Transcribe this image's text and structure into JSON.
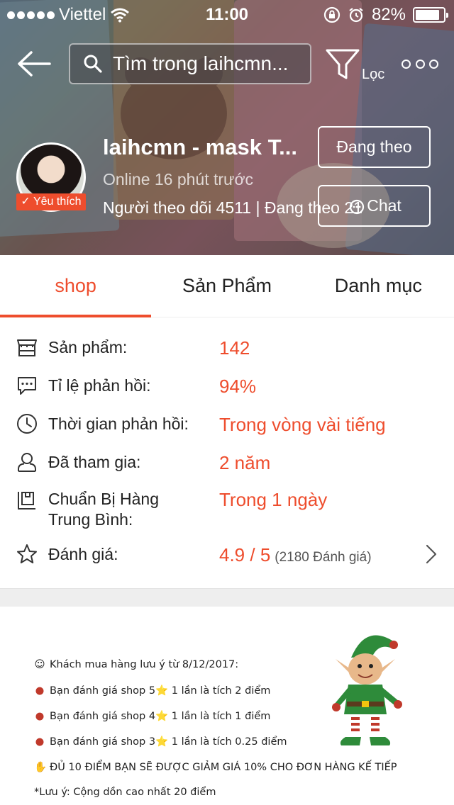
{
  "status_bar": {
    "carrier": "Viettel",
    "time": "11:00",
    "battery": "82%"
  },
  "header": {
    "search_placeholder": "Tìm trong laihcmn...",
    "filter_label": "Lọc"
  },
  "shop": {
    "name": "laihcmn - mask T...",
    "badge": "Yêu thích",
    "online": "Online 16 phút trước",
    "followers": "Người theo dõi 4511 | Đang theo 21",
    "follow_button": "Đang theo",
    "chat_button": "Chat"
  },
  "tabs": [
    {
      "label": "shop",
      "active": true
    },
    {
      "label": "Sản Phẩm",
      "active": false
    },
    {
      "label": "Danh mục",
      "active": false
    }
  ],
  "info": {
    "products_label": "Sản phẩm:",
    "products_value": "142",
    "response_rate_label": "Tỉ lệ phản hồi:",
    "response_rate_value": "94%",
    "response_time_label": "Thời gian phản hồi:",
    "response_time_value": "Trong vòng vài tiếng",
    "joined_label": "Đã tham gia:",
    "joined_value": "2 năm",
    "prep_label_1": "Chuẩn Bị Hàng",
    "prep_label_2": "Trung Bình:",
    "prep_value": "Trong 1 ngày",
    "rating_label": "Đánh giá:",
    "rating_value": "4.9 / 5",
    "rating_count": "(2180 Đánh giá)"
  },
  "notice": {
    "line1": "Khách mua hàng lưu ý từ 8/12/2017:",
    "line2": "Bạn đánh giá shop 5⭐ 1 lần là tích 2 điểm",
    "line3": "Bạn đánh giá shop 4⭐ 1 lần là tích 1 điểm",
    "line4": "Bạn đánh giá shop 3⭐ 1 lần là tích 0.25 điểm",
    "line5": "ĐỦ 10 ĐIỂM BẠN SẼ ĐƯỢC GIẢM GIÁ 10% CHO ĐƠN HÀNG KẾ TIẾP",
    "line6": "*Lưu ý: Cộng dồn cao nhất 20 điểm"
  },
  "colors": {
    "accent": "#ee4d2d"
  }
}
